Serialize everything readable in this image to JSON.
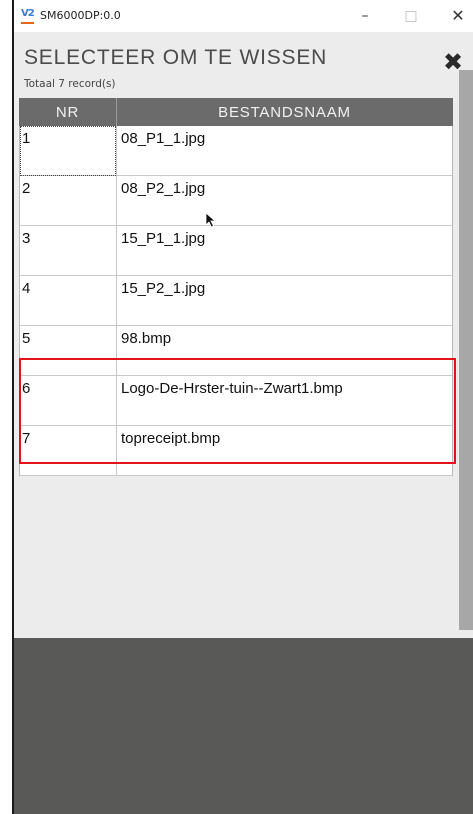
{
  "window": {
    "title": "SM6000DP:0.0",
    "app_icon_text": "V2",
    "minimize": "–",
    "maximize": "□",
    "close": "✕"
  },
  "panel": {
    "heading": "SELECTEER OM TE WISSEN",
    "subheading": "Totaal 7 record(s)",
    "close_glyph": "✖"
  },
  "table": {
    "headers": {
      "nr": "NR",
      "name": "BESTANDSNAAM"
    },
    "rows": [
      {
        "nr": "1",
        "name": "08_P1_1.jpg"
      },
      {
        "nr": "2",
        "name": "08_P2_1.jpg"
      },
      {
        "nr": "3",
        "name": "15_P1_1.jpg"
      },
      {
        "nr": "4",
        "name": "15_P2_1.jpg"
      },
      {
        "nr": "5",
        "name": "98.bmp"
      },
      {
        "nr": "6",
        "name": "Logo-De-Hrster-tuin--Zwart1.bmp"
      },
      {
        "nr": "7",
        "name": "topreceipt.bmp"
      }
    ]
  },
  "colors": {
    "header_bg": "#6b6b6b",
    "panel_bg": "#ececec",
    "footer_bg": "#595a57",
    "highlight": "#e0121b",
    "accent_icon": "#e0661b"
  }
}
